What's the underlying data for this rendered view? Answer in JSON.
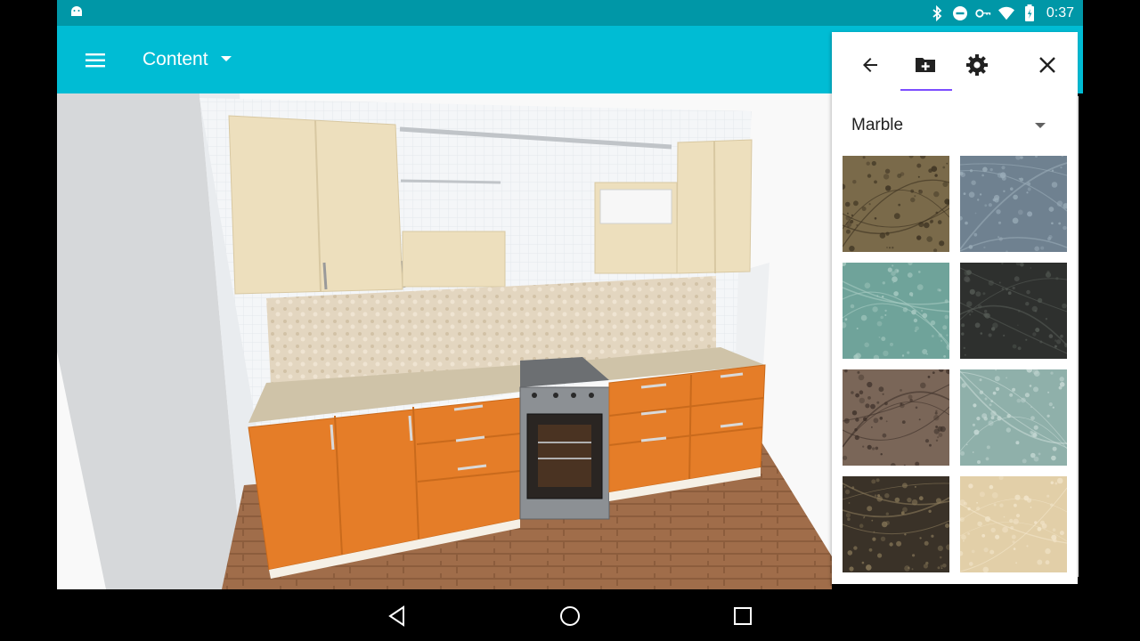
{
  "status_bar": {
    "time": "0:37",
    "icons": [
      "android-icon",
      "bluetooth-icon",
      "do-not-disturb-icon",
      "vpn-key-icon",
      "wifi-icon",
      "battery-icon"
    ]
  },
  "app_bar": {
    "menu_icon": "menu-icon",
    "title": "Content"
  },
  "panel": {
    "toolbar": [
      "back-arrow-icon",
      "add-folder-icon",
      "settings-gear-icon",
      "close-icon"
    ],
    "selected_tab": "add-folder",
    "category": "Marble",
    "swatch_colors": [
      {
        "name": "brown-granite",
        "base": "#7a6a4a",
        "accent": "#3a3020"
      },
      {
        "name": "blue-gray-marble",
        "base": "#6f8190",
        "accent": "#9aacb8"
      },
      {
        "name": "green-marble",
        "base": "#6fa39a",
        "accent": "#a9cbc3"
      },
      {
        "name": "black-marble",
        "base": "#2e302e",
        "accent": "#555a55"
      },
      {
        "name": "brown-speckled-granite",
        "base": "#7a6658",
        "accent": "#3e312a"
      },
      {
        "name": "light-teal-marble",
        "base": "#8fb0aa",
        "accent": "#c8dad6"
      },
      {
        "name": "dark-emperador-marble",
        "base": "#3a3228",
        "accent": "#8a7a5a"
      },
      {
        "name": "beige-marble",
        "base": "#e2cfa8",
        "accent": "#f3e6cc"
      }
    ]
  },
  "scene": {
    "wall_color": "#f4f6f8",
    "cabinet_top_color": "#eddfbd",
    "cabinet_bottom_color": "#e57d28",
    "countertop_color": "#cfc3a8",
    "floor_color": "#a06d4a"
  },
  "nav_bar": [
    "back-nav-icon",
    "home-nav-icon",
    "recents-nav-icon"
  ]
}
